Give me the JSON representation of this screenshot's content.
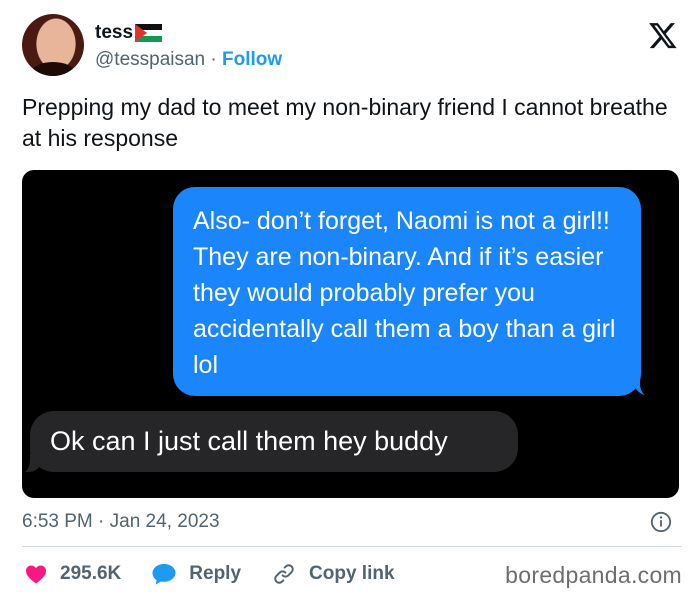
{
  "author": {
    "display_name": "tess",
    "handle": "@tesspaisan",
    "separator": "·",
    "follow_label": "Follow"
  },
  "tweet": {
    "text": "Prepping my dad to meet my non-binary friend I cannot breathe at his response"
  },
  "conversation": {
    "sent_message": "Also- don’t forget, Naomi is not a girl!! They are non-binary. And if it’s easier they would probably prefer you accidentally call them a boy than a girl lol",
    "received_message": "Ok can I just call them hey buddy"
  },
  "meta": {
    "timestamp": "6:53 PM · Jan 24, 2023"
  },
  "actions": {
    "like_count": "295.6K",
    "reply_label": "Reply",
    "copy_link_label": "Copy link"
  },
  "watermark": "boredpanda.com",
  "colors": {
    "follow": "#1d9bf0",
    "sent_bubble": "#1b86fb",
    "received_bubble": "#262629",
    "like": "#f91880",
    "reply": "#1d9bf0"
  },
  "icons": [
    "x-logo-icon",
    "flag-icon",
    "info-icon",
    "heart-icon",
    "reply-bubble-icon",
    "link-icon"
  ]
}
